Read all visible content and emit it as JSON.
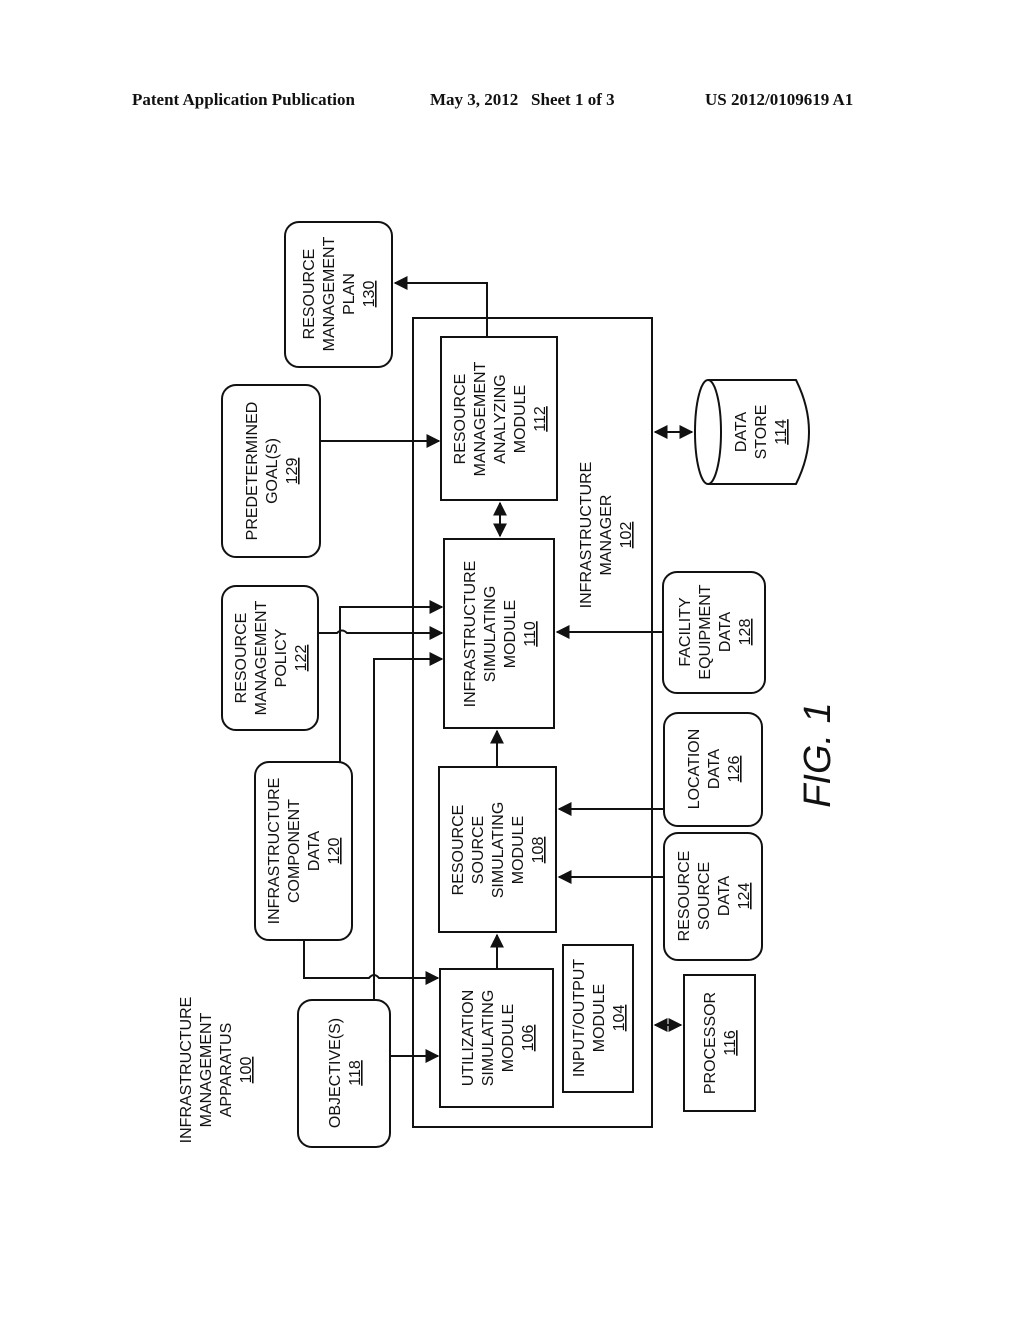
{
  "header": {
    "publication": "Patent Application Publication",
    "date_sheet": "May 3, 2012   Sheet 1 of 3",
    "number": "US 2012/0109619 A1"
  },
  "figure": {
    "caption": "FIG. 1",
    "apparatus": {
      "lines": [
        "INFRASTRUCTURE",
        "MANAGEMENT",
        "APPARATUS"
      ],
      "ref": "100"
    },
    "manager": {
      "lines": [
        "INFRASTRUCTURE",
        "MANAGER"
      ],
      "ref": "102"
    },
    "modules": {
      "io": {
        "lines": [
          "INPUT/OUTPUT",
          "MODULE"
        ],
        "ref": "104"
      },
      "utilization": {
        "lines": [
          "UTILIZATION",
          "SIMULATING",
          "MODULE"
        ],
        "ref": "106"
      },
      "resource_source": {
        "lines": [
          "RESOURCE",
          "SOURCE",
          "SIMULATING",
          "MODULE"
        ],
        "ref": "108"
      },
      "infrastructure": {
        "lines": [
          "INFRASTRUCTURE",
          "SIMULATING",
          "MODULE"
        ],
        "ref": "110"
      },
      "analyzing": {
        "lines": [
          "RESOURCE",
          "MANAGEMENT",
          "ANALYZING",
          "MODULE"
        ],
        "ref": "112"
      }
    },
    "data_store": {
      "lines": [
        "DATA",
        "STORE"
      ],
      "ref": "114"
    },
    "processor": {
      "lines": [
        "PROCESSOR"
      ],
      "ref": "116"
    },
    "inputs": {
      "objectives": {
        "lines": [
          "OBJECTIVE(S)"
        ],
        "ref": "118"
      },
      "component_data": {
        "lines": [
          "INFRASTRUCTURE",
          "COMPONENT",
          "DATA"
        ],
        "ref": "120"
      },
      "policy": {
        "lines": [
          "RESOURCE",
          "MANAGEMENT",
          "POLICY"
        ],
        "ref": "122"
      },
      "resource_source_data": {
        "lines": [
          "RESOURCE",
          "SOURCE",
          "DATA"
        ],
        "ref": "124"
      },
      "location_data": {
        "lines": [
          "LOCATION",
          "DATA"
        ],
        "ref": "126"
      },
      "facility_data": {
        "lines": [
          "FACILITY",
          "EQUIPMENT",
          "DATA"
        ],
        "ref": "128"
      },
      "goals": {
        "lines": [
          "PREDETERMINED",
          "GOAL(S)"
        ],
        "ref": "129"
      }
    },
    "output": {
      "plan": {
        "lines": [
          "RESOURCE",
          "MANAGEMENT",
          "PLAN"
        ],
        "ref": "130"
      }
    }
  }
}
